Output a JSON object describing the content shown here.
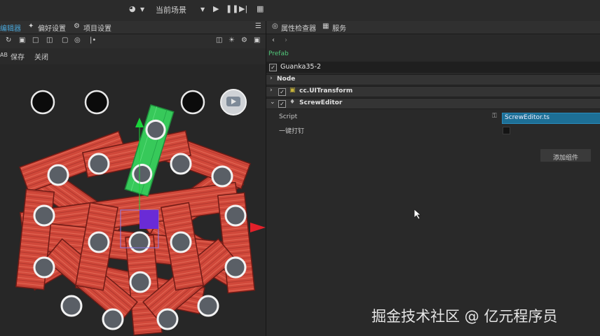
{
  "toolbar": {
    "scene_label": "当前场景"
  },
  "left_panel": {
    "tabs": [
      "编辑器",
      "偏好设置",
      "项目设置"
    ],
    "actions": {
      "prefix": "AB",
      "save": "保存",
      "close": "关闭"
    }
  },
  "right_panel": {
    "tabs": [
      "属性检查器",
      "服务"
    ],
    "prefab_label": "Prefab",
    "node_name": "Guanka35-2",
    "node_section": "Node",
    "components": [
      "cc.UITransform",
      "ScrewEditor"
    ],
    "props": [
      {
        "label": "Script",
        "value": "ScrewEditor.ts"
      },
      {
        "label": "一键打钉",
        "value": ""
      }
    ],
    "add_component": "添加组件"
  },
  "watermark": "掘金技术社区 @ 亿元程序员",
  "colors": {
    "accent": "#4aa6d8",
    "prefab": "#52c87a",
    "plank": "#d0483a",
    "green_plank": "#37c95a",
    "handle": "#6a2bd6",
    "arrow": "#e3202a"
  },
  "icons": [
    "run-icon",
    "play-icon",
    "pause-icon",
    "step-icon",
    "grid-icon",
    "menu-icon",
    "gear-icon",
    "wrench-icon",
    "lock-icon",
    "back-icon",
    "forward-icon",
    "transform-icon",
    "puzzle-icon",
    "cursor-icon"
  ]
}
